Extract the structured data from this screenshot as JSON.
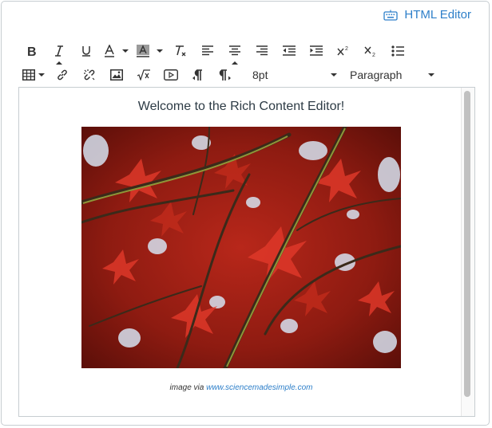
{
  "header": {
    "html_editor_label": "HTML Editor",
    "html_editor_icon": "keyboard-icon"
  },
  "toolbar": {
    "row1": [
      {
        "name": "bold-button",
        "icon": "bold-icon",
        "has_dropdown": false,
        "active": false
      },
      {
        "name": "italic-button",
        "icon": "italic-icon",
        "has_dropdown": false,
        "active": true
      },
      {
        "name": "underline-button",
        "icon": "underline-icon",
        "has_dropdown": false,
        "active": false
      },
      {
        "name": "text-color-button",
        "icon": "text-color-icon",
        "has_dropdown": true,
        "active": false
      },
      {
        "name": "background-color-button",
        "icon": "background-color-icon",
        "has_dropdown": true,
        "active": false
      },
      {
        "name": "clear-formatting-button",
        "icon": "clear-formatting-icon",
        "has_dropdown": false,
        "active": false
      },
      {
        "name": "align-left-button",
        "icon": "align-left-icon",
        "has_dropdown": false,
        "active": false
      },
      {
        "name": "align-center-button",
        "icon": "align-center-icon",
        "has_dropdown": false,
        "active": true
      },
      {
        "name": "align-right-button",
        "icon": "align-right-icon",
        "has_dropdown": false,
        "active": false
      },
      {
        "name": "outdent-button",
        "icon": "outdent-icon",
        "has_dropdown": false,
        "active": false
      },
      {
        "name": "indent-button",
        "icon": "indent-icon",
        "has_dropdown": false,
        "active": false
      },
      {
        "name": "superscript-button",
        "icon": "superscript-icon",
        "has_dropdown": false,
        "active": false
      },
      {
        "name": "subscript-button",
        "icon": "subscript-icon",
        "has_dropdown": false,
        "active": false
      },
      {
        "name": "bullet-list-button",
        "icon": "bullet-list-icon",
        "has_dropdown": false,
        "active": false
      }
    ],
    "row2": [
      {
        "name": "table-button",
        "icon": "table-icon",
        "has_dropdown": true
      },
      {
        "name": "link-button",
        "icon": "link-icon",
        "has_dropdown": false
      },
      {
        "name": "unlink-button",
        "icon": "unlink-icon",
        "has_dropdown": false
      },
      {
        "name": "image-button",
        "icon": "image-icon",
        "has_dropdown": false
      },
      {
        "name": "math-equation-button",
        "icon": "math-equation-icon",
        "has_dropdown": false
      },
      {
        "name": "media-button",
        "icon": "media-icon",
        "has_dropdown": false
      },
      {
        "name": "ltr-direction-button",
        "icon": "pilcrow-ltr-icon",
        "has_dropdown": false
      },
      {
        "name": "rtl-direction-button",
        "icon": "pilcrow-rtl-icon",
        "has_dropdown": false
      }
    ],
    "font_size_value": "8pt",
    "block_format_value": "Paragraph"
  },
  "content": {
    "heading": "Welcome to the Rich Content Editor!",
    "image_alt": "red maple leaves",
    "caption_prefix": "image via ",
    "caption_link": "www.sciencemadesimple.com"
  },
  "colors": {
    "link_blue": "#2d7fc9",
    "border": "#c7cdd1",
    "text_dark": "#2d3b45"
  }
}
